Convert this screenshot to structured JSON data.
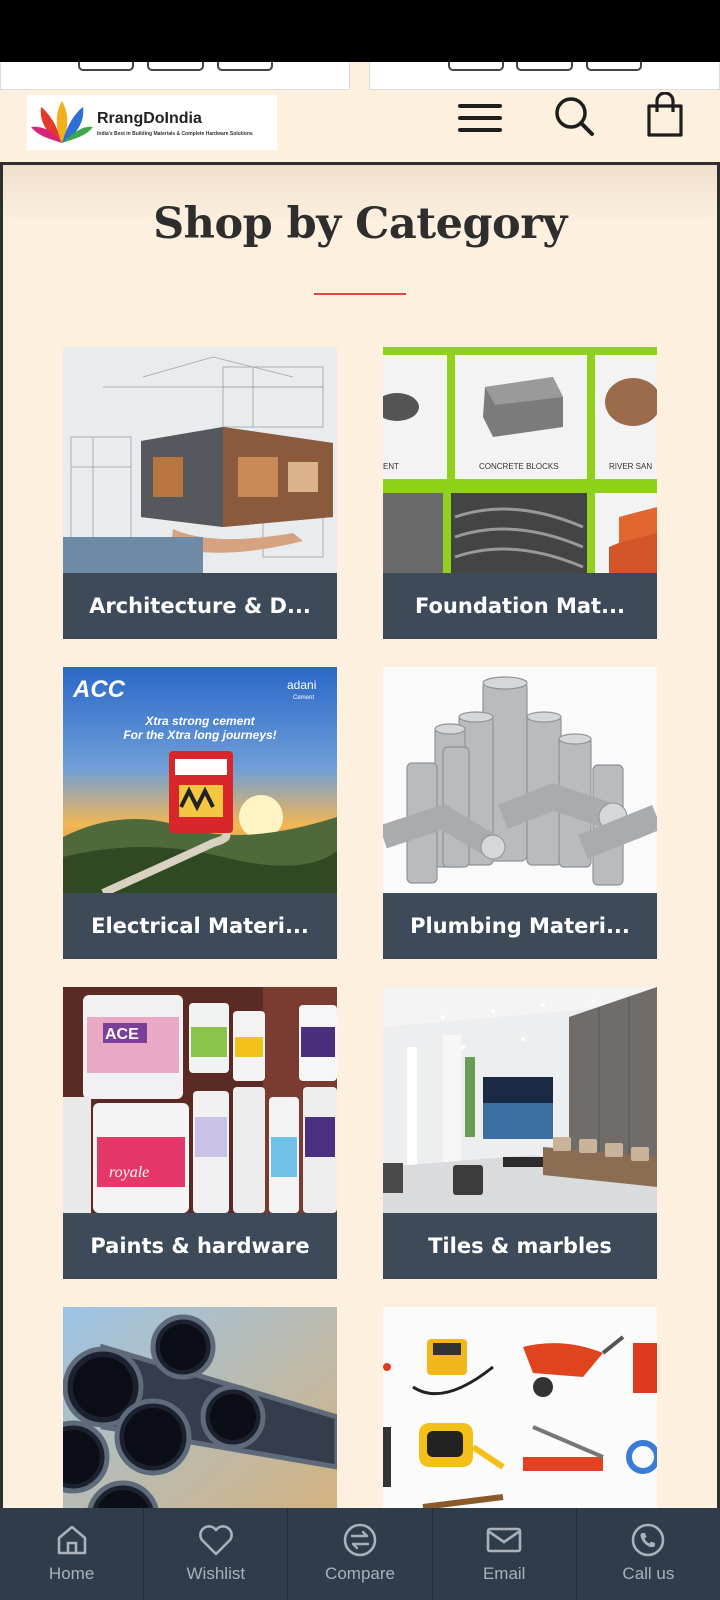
{
  "brand": {
    "name": "RrangDoIndia",
    "tagline": "India's Best in Building Materials & Complete Hardware Solutions"
  },
  "header": {
    "menu_icon": "hamburger-menu-icon",
    "search_icon": "search-icon",
    "cart_icon": "shopping-bag-icon"
  },
  "section": {
    "title": "Shop by Category",
    "accent_color": "#e0473d"
  },
  "categories": [
    {
      "label": "Architecture & D...",
      "image": "architecture-house-model"
    },
    {
      "label": "Foundation Mat...",
      "image": "foundation-materials-grid",
      "image_texts": [
        "ENT",
        "CONCRETE BLOCKS",
        "RIVER SAN"
      ]
    },
    {
      "label": "Electrical Materi...",
      "image": "acc-cement-ad",
      "image_texts": [
        "ACC",
        "adani",
        "Cement",
        "Xtra strong cement",
        "For the Xtra long journeys!"
      ]
    },
    {
      "label": "Plumbing Materi...",
      "image": "pvc-pipes"
    },
    {
      "label": "Paints & hardware",
      "image": "paint-buckets",
      "image_texts": [
        "ACE",
        "royale"
      ]
    },
    {
      "label": "Tiles & marbles",
      "image": "tiled-interior"
    },
    {
      "label": "",
      "image": "steel-pipes"
    },
    {
      "label": "",
      "image": "construction-tools"
    }
  ],
  "colors": {
    "background": "#fdf0df",
    "card_label_bg": "#3c4a59",
    "nav_bg": "#2f3c4a"
  },
  "bottom_nav": [
    {
      "label": "Home",
      "icon": "home-icon"
    },
    {
      "label": "Wishlist",
      "icon": "heart-icon"
    },
    {
      "label": "Compare",
      "icon": "compare-arrows-icon"
    },
    {
      "label": "Email",
      "icon": "envelope-icon"
    },
    {
      "label": "Call us",
      "icon": "phone-icon"
    }
  ]
}
